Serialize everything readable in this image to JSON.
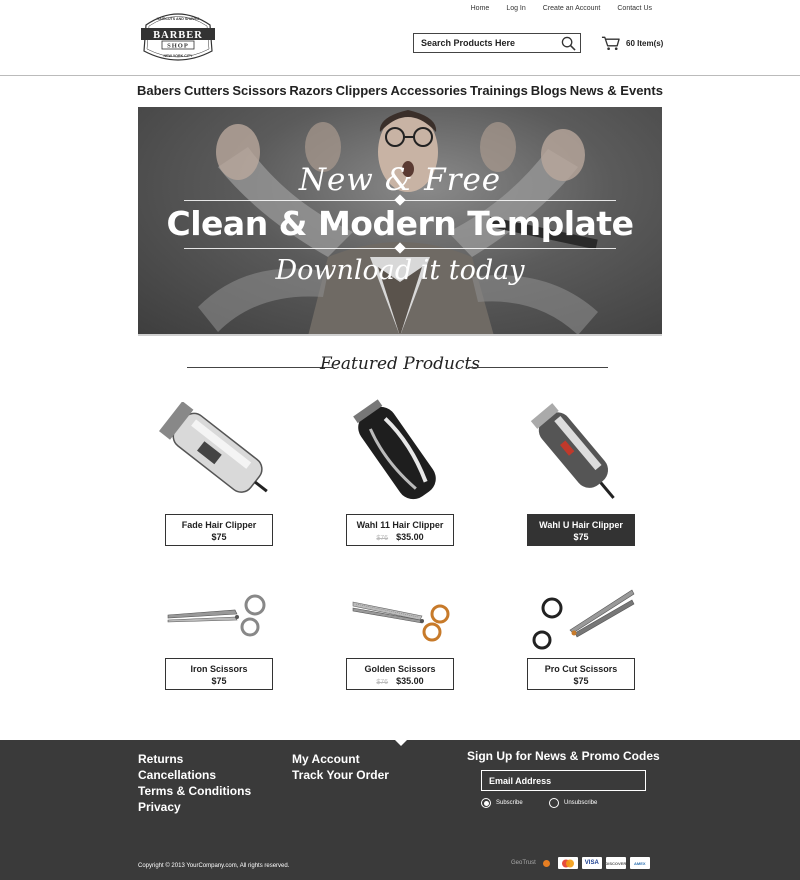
{
  "logo": {
    "top": "HAIRCUTS AND SHAVES",
    "main": "BARBER",
    "sub": "SHOP",
    "bottom": "NEW YORK CITY"
  },
  "toplinks": [
    "Home",
    "Log In",
    "Create an Account",
    "Contact Us"
  ],
  "search": {
    "placeholder": "Search Products Here"
  },
  "cart": {
    "label": "60 Item(s)"
  },
  "nav": [
    "Babers",
    "Cutters",
    "Scissors",
    "Razors",
    "Clippers",
    "Accessories",
    "Trainings",
    "Blogs",
    "News & Events"
  ],
  "hero": {
    "script1": "New & Free",
    "headline": "Clean & Modern Template",
    "script2": "Download it today"
  },
  "featured": {
    "title": "Featured Products"
  },
  "products": [
    {
      "name": "Fade Hair Clipper",
      "old": "",
      "price": "$75"
    },
    {
      "name": "Wahl 11 Hair Clipper",
      "old": "$76",
      "price": "$35.00"
    },
    {
      "name": "Wahl U Hair Clipper",
      "old": "",
      "price": "$75"
    },
    {
      "name": "Iron Scissors",
      "old": "",
      "price": "$75"
    },
    {
      "name": "Golden Scissors",
      "old": "$76",
      "price": "$35.00"
    },
    {
      "name": "Pro Cut Scissors",
      "old": "",
      "price": "$75"
    }
  ],
  "footer": {
    "col1": [
      "Returns",
      "Cancellations",
      "Terms & Conditions",
      "Privacy"
    ],
    "col2": [
      "My Account",
      "Track Your Order"
    ],
    "signup_title": "Sign Up for News & Promo Codes",
    "email_placeholder": "Email Address",
    "subscribe": "Subscribe",
    "unsubscribe": "Unsubscribe",
    "copyright": "Copyright © 2013 YourCompany.com, All rights reserved.",
    "geotrust": "GeoTrust",
    "cards": [
      "MasterCard",
      "VISA",
      "DISCOVER",
      "AMEX"
    ]
  },
  "colors": {
    "footer_bg": "#3a3a3a",
    "dark_label": "#333333"
  }
}
